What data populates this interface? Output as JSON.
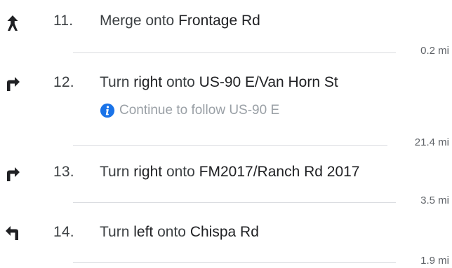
{
  "steps": [
    {
      "number": "11.",
      "maneuver_icon": "straight-merge-icon",
      "verb": "Merge onto",
      "direction": "",
      "preposition": "",
      "road": "Frontage Rd",
      "distance": "0.2 mi"
    },
    {
      "number": "12.",
      "maneuver_icon": "turn-right-icon",
      "verb": "Turn",
      "direction": "right",
      "preposition": "onto",
      "road": "US-90 E/Van Horn St",
      "note": "Continue to follow US-90 E",
      "note_icon": "info-icon",
      "distance": "21.4 mi"
    },
    {
      "number": "13.",
      "maneuver_icon": "turn-right-icon",
      "verb": "Turn",
      "direction": "right",
      "preposition": "onto",
      "road": "FM2017/Ranch Rd 2017",
      "distance": "3.5 mi"
    },
    {
      "number": "14.",
      "maneuver_icon": "turn-left-icon",
      "verb": "Turn",
      "direction": "left",
      "preposition": "onto",
      "road": "Chispa Rd",
      "distance": "1.9 mi"
    }
  ],
  "colors": {
    "text": "#3c4043",
    "muted": "#9aa0a6",
    "info_blue": "#1a73e8",
    "divider": "#dadce0"
  }
}
